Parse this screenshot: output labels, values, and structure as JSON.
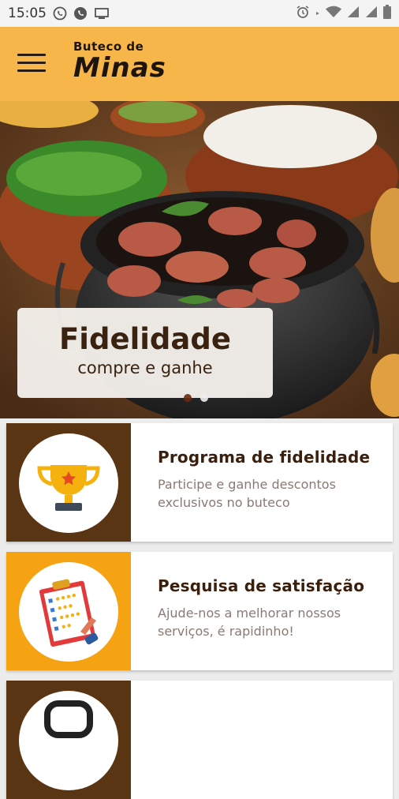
{
  "status_bar": {
    "time": "15:05",
    "left_icons": [
      "whatsapp-icon",
      "phone-icon",
      "cast-icon"
    ],
    "right_icons": [
      "alarm-icon",
      "signal-dot-icon",
      "wifi-icon",
      "signal-icon",
      "signal-icon",
      "battery-icon"
    ]
  },
  "toolbar": {
    "logo_line1": "Buteco de",
    "logo_line2": "Minas",
    "background_color": "#f7b64a"
  },
  "hero": {
    "title": "Fidelidade",
    "subtitle": "compre e ganhe",
    "slides": 2,
    "active_slide": 1
  },
  "cards": [
    {
      "title": "Programa de fidelidade",
      "description": "Participe e ganhe descontos exclusivos no buteco",
      "icon": "trophy-icon",
      "panel_color": "#5a3514"
    },
    {
      "title": "Pesquisa de satisfação",
      "description": "Ajude-nos a melhorar nossos serviços, é rapidinho!",
      "icon": "clipboard-survey-icon",
      "panel_color": "#f5a313"
    },
    {
      "title": "",
      "description": "",
      "icon": "card-icon",
      "panel_color": "#5a3514"
    }
  ]
}
